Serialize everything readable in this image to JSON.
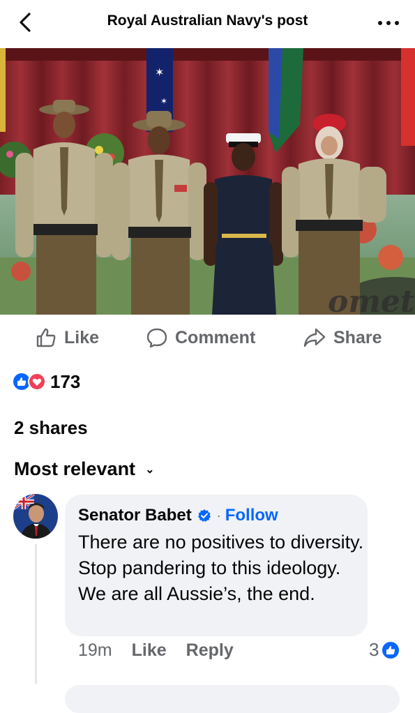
{
  "header": {
    "title": "Royal Australian Navy's post",
    "back_icon": "chevron-left-icon",
    "more_icon": "more-horizontal-icon"
  },
  "post": {
    "image_description": "group-photo",
    "actions": {
      "like_label": "Like",
      "comment_label": "Comment",
      "share_label": "Share"
    },
    "reactions": {
      "icons": [
        "like-reaction-icon",
        "love-reaction-icon"
      ],
      "count": "173"
    },
    "shares_text": "2 shares"
  },
  "comments": {
    "sort_label": "Most relevant",
    "items": [
      {
        "author": "Senator Babet",
        "follow_label": "Follow",
        "separator": "·",
        "text": "There are no positives to diversity. Stop pandering to this ideology. We are all Aussie’s, the end.",
        "time": "19m",
        "like_label": "Like",
        "reply_label": "Reply",
        "like_count": "3"
      }
    ]
  },
  "colors": {
    "accent": "#0866ff",
    "secondary_text": "#65676b",
    "bubble": "#f0f2f5",
    "love": "#f33e58"
  }
}
